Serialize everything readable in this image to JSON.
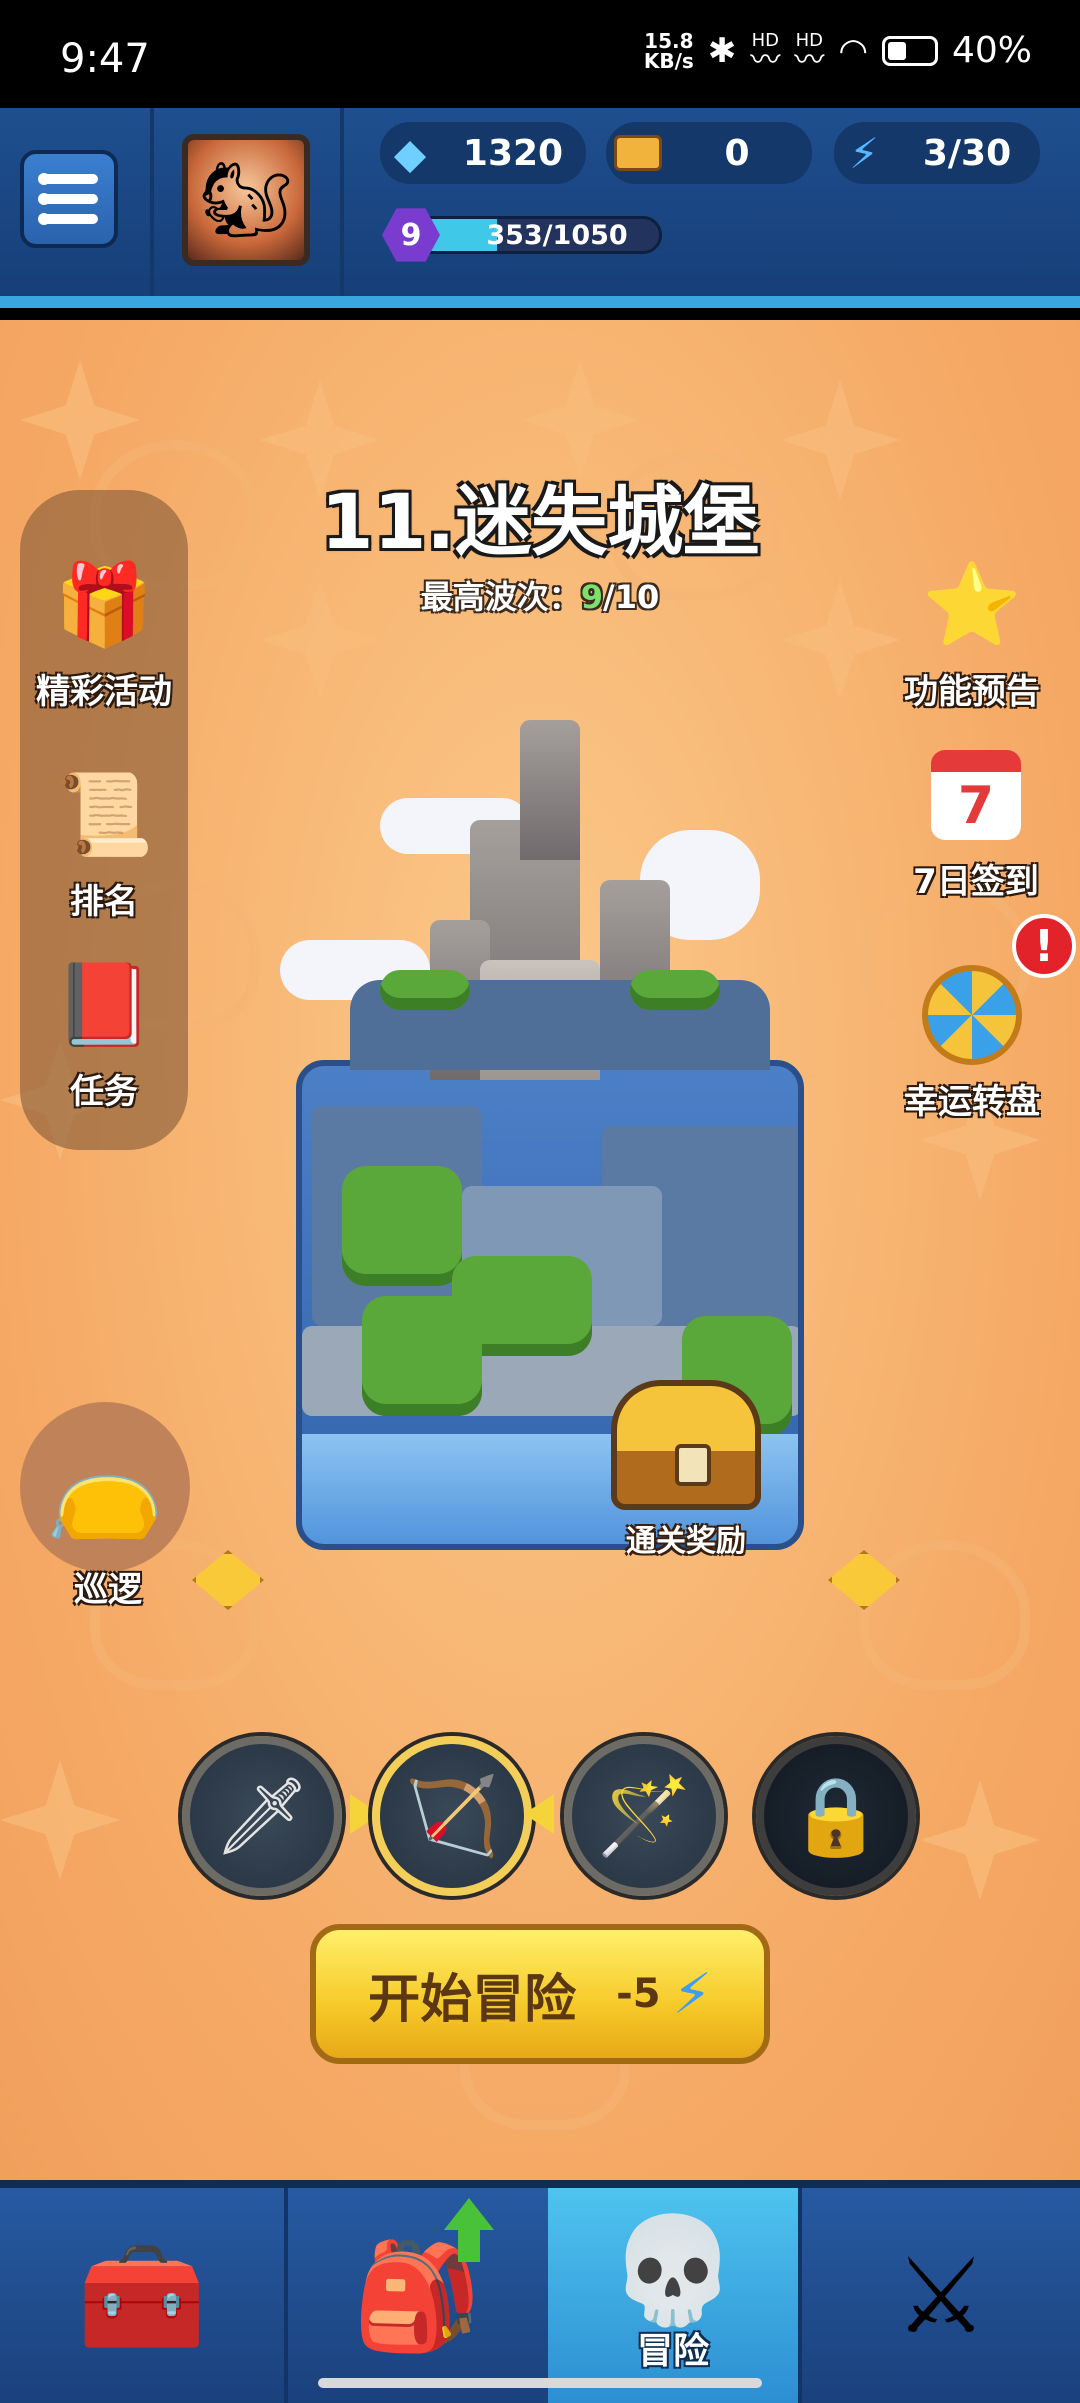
{
  "status_bar": {
    "time": "9:47",
    "net_speed_value": "15.8",
    "net_speed_unit": "KB/s",
    "hd1": "HD",
    "hd2": "HD",
    "battery_percent": "40%",
    "battery_level": 0.4
  },
  "hud": {
    "gems": "1320",
    "tickets": "0",
    "energy": "3/30",
    "level": "9",
    "xp": "353/1050",
    "xp_fraction": 0.336
  },
  "stage": {
    "title": "11.迷失城堡",
    "best_wave_label": "最高波次：",
    "best_wave_current": "9",
    "best_wave_total": "/10",
    "reward_label": "通关奖励"
  },
  "left_menu": {
    "events": "精彩活动",
    "ranking": "排名",
    "tasks": "任务",
    "patrol": "巡逻"
  },
  "right_menu": {
    "preview": "功能预告",
    "signin": "7日签到",
    "signin_day": "7",
    "wheel": "幸运转盘",
    "alert": "!"
  },
  "start": {
    "label": "开始冒险",
    "cost": "-5"
  },
  "nav": {
    "adventure": "冒险"
  },
  "colors": {
    "hud_bg": "#1f4f8f",
    "main_bg": "#f5a965",
    "accent_yellow": "#f6c928",
    "active_tab": "#4ec4ef"
  },
  "icons": {
    "menu": "menu-icon",
    "gem": "diamond-icon",
    "ticket": "ticket-icon",
    "energy": "lightning-icon",
    "sword": "sword-icon",
    "bow": "bow-icon",
    "staff": "staff-icon",
    "lock": "lock-icon"
  }
}
